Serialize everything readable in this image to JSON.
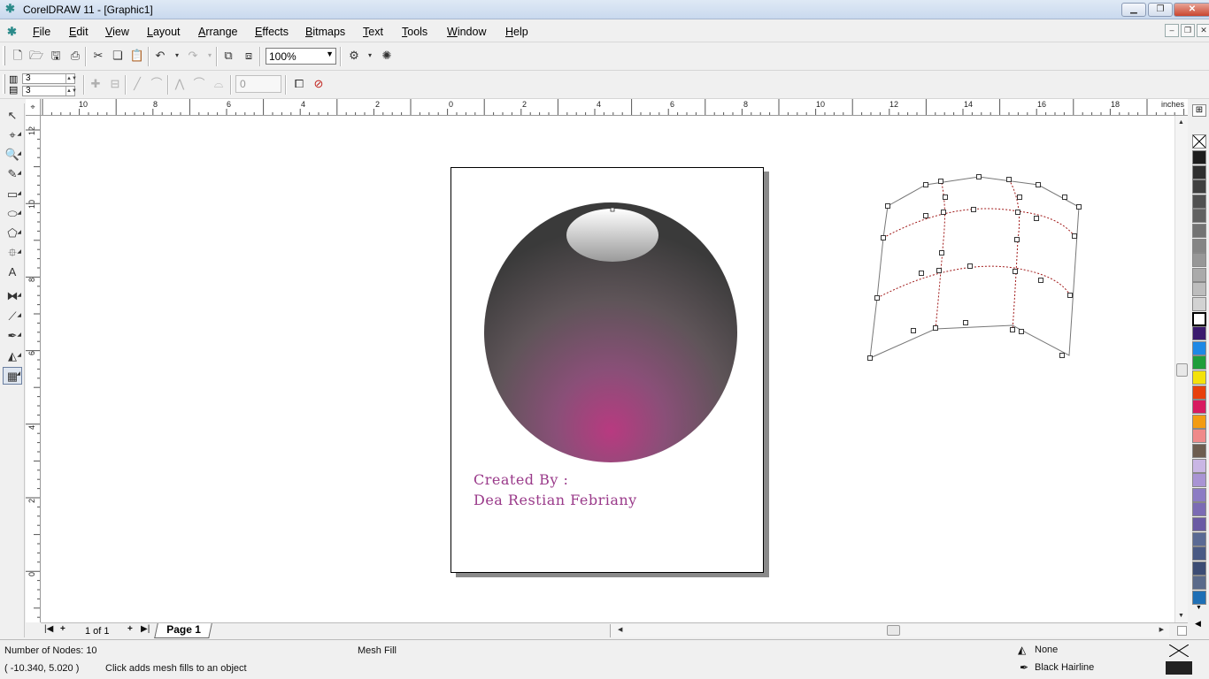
{
  "window": {
    "title": "CorelDRAW 11 - [Graphic1]",
    "min_glyph": "▁",
    "restore_glyph": "❐",
    "close_glyph": "✕"
  },
  "menu": {
    "items": [
      "File",
      "Edit",
      "View",
      "Layout",
      "Arrange",
      "Effects",
      "Bitmaps",
      "Text",
      "Tools",
      "Window",
      "Help"
    ],
    "mdi_min": "–",
    "mdi_restore": "❐",
    "mdi_close": "✕"
  },
  "standard_toolbar": {
    "zoom_value": "100%",
    "zoom_arrow": "▼"
  },
  "property_bar": {
    "columns_value": "3",
    "rows_value": "3",
    "columns_icon": "▥",
    "rows_icon": "▤",
    "smoothness_value": "0",
    "spin_arrows": "▲▼"
  },
  "ruler": {
    "unit": "inches",
    "h_labels": [
      "10",
      "8",
      "6",
      "4",
      "2",
      "0",
      "2",
      "4",
      "6",
      "8",
      "10",
      "12",
      "14",
      "16",
      "18"
    ],
    "v_labels": [
      "12",
      "10",
      "8",
      "6",
      "4",
      "2",
      "0"
    ],
    "corner_glyph": "⌖"
  },
  "document": {
    "credit_line1": "Created By :",
    "credit_line2": "Dea Restian Febriany",
    "accent_color": "#9a3a8a"
  },
  "page_nav": {
    "page_count": "1 of 1",
    "page_tab": "Page 1",
    "first": "|◀",
    "add_before": "+",
    "add_after": "+",
    "last": "▶|"
  },
  "status": {
    "nodes": "Number of Nodes: 10",
    "object_type": "Mesh Fill",
    "coords": "( -10.340, 5.020  )",
    "hint": "Click adds mesh fills to an object",
    "fill_label": "None",
    "outline_label": "Black  Hairline"
  },
  "palette": {
    "colors": [
      "#1c1c1c",
      "#2e2e2e",
      "#3f3f3f",
      "#505050",
      "#616161",
      "#737373",
      "#858585",
      "#979797",
      "#aaaaaa",
      "#bdbdbd",
      "#d2d2d2",
      "#ffffff",
      "#3a1a6e",
      "#1e88e5",
      "#1f9e3a",
      "#f4e20a",
      "#e8400c",
      "#d81b60",
      "#f39c12",
      "#ef8a8a",
      "#6d5d50",
      "#c9b6e4",
      "#a994d4",
      "#8c7cc4",
      "#7b6bb4",
      "#6a5aa4",
      "#5a6a94",
      "#4a5a84",
      "#3c4c74",
      "#5a6a8a",
      "#1f6fb5"
    ]
  }
}
